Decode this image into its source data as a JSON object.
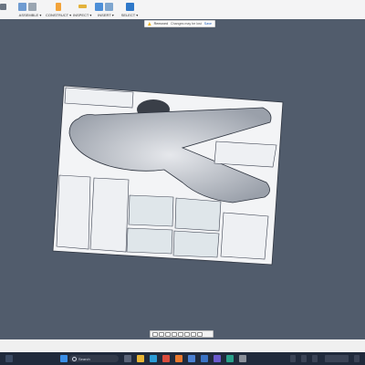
{
  "toolbar": {
    "groups": [
      {
        "label": "ASSEMBLE ▾"
      },
      {
        "label": "CONSTRUCT ▾"
      },
      {
        "label": "INSPECT ▾"
      },
      {
        "label": "INSERT ▾"
      },
      {
        "label": "SELECT ▾"
      }
    ]
  },
  "notice": {
    "status": "Removed",
    "message": "Changes may be lost",
    "action": "Save"
  },
  "taskbar": {
    "search_placeholder": "Search"
  },
  "colors": {
    "viewport": "#515c6c",
    "model_surface": "#eef0f3",
    "taskbar": "#202a3c",
    "accent_blue": "#2f78c9",
    "warning": "#f2b51d"
  }
}
